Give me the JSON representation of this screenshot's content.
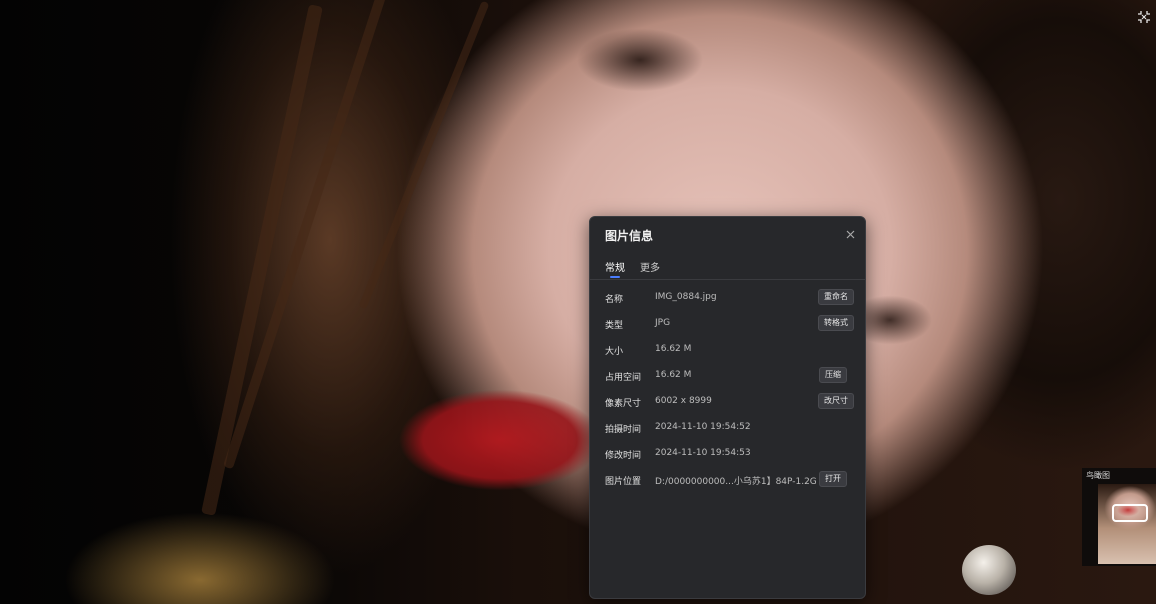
{
  "dialog": {
    "title": "图片信息",
    "tabs": [
      {
        "label": "常规",
        "active": true
      },
      {
        "label": "更多",
        "active": false
      }
    ],
    "rows": [
      {
        "label": "名称",
        "value": "IMG_0884.jpg",
        "button": "重命名"
      },
      {
        "label": "类型",
        "value": "JPG",
        "button": "转格式"
      },
      {
        "label": "大小",
        "value": "16.62 M",
        "button": ""
      },
      {
        "label": "占用空间",
        "value": "16.62 M",
        "button": "压缩"
      },
      {
        "label": "像素尺寸",
        "value": "6002 x 8999",
        "button": "改尺寸"
      },
      {
        "label": "拍摄时间",
        "value": "2024-11-10 19:54:52",
        "button": ""
      },
      {
        "label": "修改时间",
        "value": "2024-11-10 19:54:53",
        "button": ""
      },
      {
        "label": "图片位置",
        "value": "D:/0000000000...小乌苏1】84P-1.2G",
        "button": "打开"
      }
    ]
  },
  "navigator": {
    "title": "鸟瞰图"
  },
  "icons": {
    "close": "close-icon",
    "fullscreen": "exit-fullscreen-icon"
  },
  "colors": {
    "dialog_bg": "#27282b",
    "tab_accent": "#4a7dff"
  }
}
